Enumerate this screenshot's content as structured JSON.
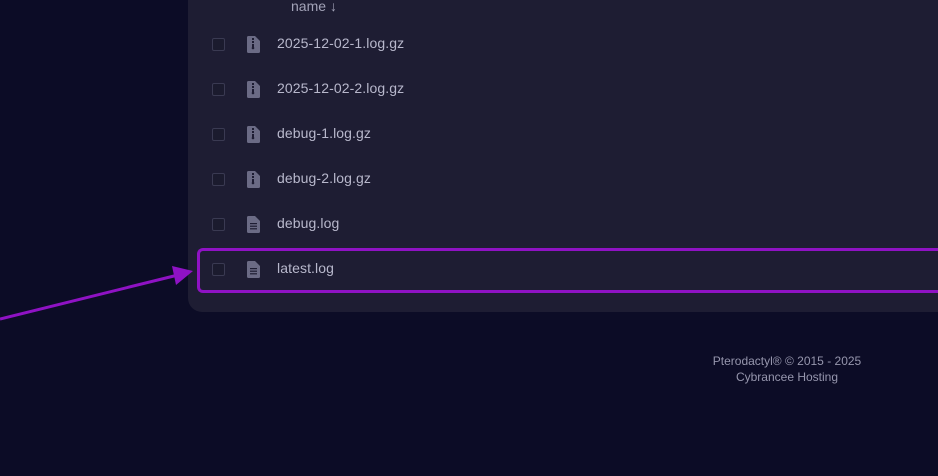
{
  "file_list": {
    "sort_label": "name",
    "sort_arrow": "↓",
    "files": [
      {
        "name": "2025-12-02-1.log.gz",
        "icon": "archive-file-icon"
      },
      {
        "name": "2025-12-02-2.log.gz",
        "icon": "archive-file-icon"
      },
      {
        "name": "debug-1.log.gz",
        "icon": "archive-file-icon"
      },
      {
        "name": "debug-2.log.gz",
        "icon": "archive-file-icon"
      },
      {
        "name": "debug.log",
        "icon": "text-file-icon"
      },
      {
        "name": "latest.log",
        "icon": "text-file-icon",
        "highlighted": true
      }
    ]
  },
  "footer": {
    "copyright": "Pterodactyl® © 2015 - 2025",
    "host": "Cybrancee Hosting"
  },
  "annotation": {
    "highlight_color": "#8f12c4",
    "arrow_color": "#8f12c4"
  }
}
